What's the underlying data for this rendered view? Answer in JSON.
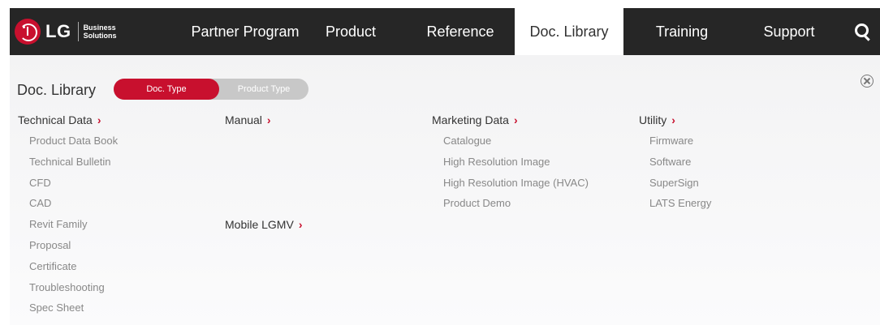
{
  "brand": {
    "logo_text": "LG",
    "sub_line1": "Business",
    "sub_line2": "Solutions"
  },
  "nav": {
    "items": [
      {
        "label": "Partner Program"
      },
      {
        "label": "Product"
      },
      {
        "label": "Reference"
      },
      {
        "label": "Doc. Library",
        "active": true
      },
      {
        "label": "Training"
      },
      {
        "label": "Support"
      }
    ],
    "search_icon": "search-icon"
  },
  "panel": {
    "title": "Doc. Library",
    "toggle": {
      "active_label": "Doc. Type",
      "inactive_label": "Product Type"
    },
    "close_icon": "close-circle-icon",
    "columns": [
      {
        "heading": "Technical Data",
        "items": [
          "Product Data Book",
          "Technical Bulletin",
          "CFD",
          "CAD",
          "Revit Family",
          "Proposal",
          "Certificate",
          "Troubleshooting",
          "Spec Sheet"
        ]
      },
      {
        "heading": "Manual",
        "items": []
      },
      {
        "heading": "Mobile LGMV",
        "items": []
      },
      {
        "heading": "Marketing Data",
        "items": [
          "Catalogue",
          "High Resolution Image",
          "High Resolution Image (HVAC)",
          "Product Demo"
        ]
      },
      {
        "heading": "Utility",
        "items": [
          "Firmware",
          "Software",
          "SuperSign",
          "LATS Energy"
        ]
      }
    ]
  },
  "colors": {
    "accent": "#c8102e",
    "navbar": "#262626",
    "panel_bg": "#f5f5f6"
  }
}
